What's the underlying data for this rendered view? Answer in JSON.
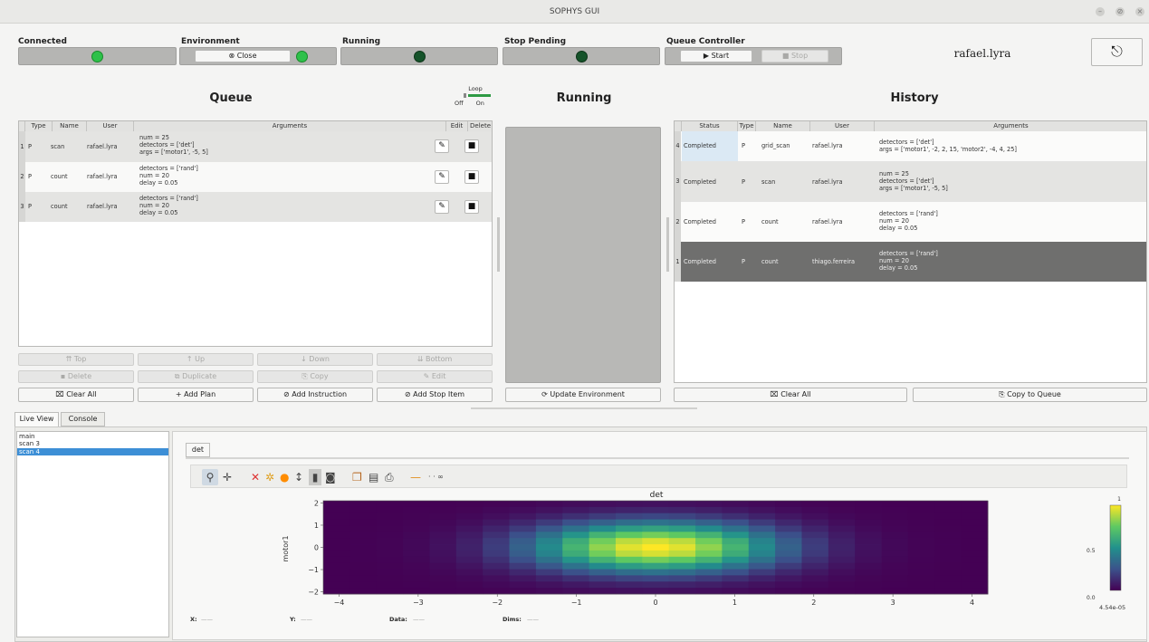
{
  "window": {
    "title": "SOPHYS GUI",
    "controls": [
      "–",
      "⊘",
      "×"
    ]
  },
  "status": {
    "connected": "Connected",
    "environment": "Environment",
    "close_label": "Close",
    "running": "Running",
    "stop_pending": "Stop Pending",
    "queue_controller": "Queue Controller",
    "start_label": "Start",
    "stop_label": "Stop",
    "user": "rafael.lyra"
  },
  "queue": {
    "title": "Queue",
    "loop_label": "Loop",
    "loop_off": "Off",
    "loop_on": "On",
    "columns": [
      "Type",
      "Name",
      "User",
      "Arguments",
      "Edit",
      "Delete"
    ],
    "rows": [
      {
        "num": "1",
        "type": "P",
        "name": "scan",
        "user": "rafael.lyra",
        "args": [
          "num = 25",
          "detectors = ['det']",
          "args = ['motor1', -5, 5]"
        ]
      },
      {
        "num": "2",
        "type": "P",
        "name": "count",
        "user": "rafael.lyra",
        "args": [
          "detectors = ['rand']",
          "num = 20",
          "delay = 0.05"
        ]
      },
      {
        "num": "3",
        "type": "P",
        "name": "count",
        "user": "rafael.lyra",
        "args": [
          "detectors = ['rand']",
          "num = 20",
          "delay = 0.05"
        ]
      }
    ],
    "buttons": {
      "top": "Top",
      "up": "Up",
      "down": "Down",
      "bottom": "Bottom",
      "delete": "Delete",
      "duplicate": "Duplicate",
      "copy": "Copy",
      "edit": "Edit",
      "clear_all": "Clear All",
      "add_plan": "Add Plan",
      "add_instruction": "Add Instruction",
      "add_stop_item": "Add Stop Item"
    }
  },
  "running": {
    "title": "Running",
    "update_env": "Update Environment"
  },
  "history": {
    "title": "History",
    "columns": [
      "Status",
      "Type",
      "Name",
      "User",
      "Arguments"
    ],
    "rows": [
      {
        "num": "4",
        "status": "Completed",
        "type": "P",
        "name": "grid_scan",
        "user": "rafael.lyra",
        "args": [
          "detectors = ['det']",
          "args = ['motor1', -2, 2, 15, 'motor2', -4, 4, 25]"
        ]
      },
      {
        "num": "3",
        "status": "Completed",
        "type": "P",
        "name": "scan",
        "user": "rafael.lyra",
        "args": [
          "num = 25",
          "detectors = ['det']",
          "args = ['motor1', -5, 5]"
        ]
      },
      {
        "num": "2",
        "status": "Completed",
        "type": "P",
        "name": "count",
        "user": "rafael.lyra",
        "args": [
          "detectors = ['rand']",
          "num = 20",
          "delay = 0.05"
        ]
      },
      {
        "num": "1",
        "status": "Completed",
        "type": "P",
        "name": "count",
        "user": "thiago.ferreira",
        "args": [
          "detectors = ['rand']",
          "num = 20",
          "delay = 0.05"
        ]
      }
    ],
    "buttons": {
      "clear_all": "Clear All",
      "copy_to_queue": "Copy to Queue"
    }
  },
  "bottom": {
    "tabs": [
      "Live View",
      "Console"
    ],
    "runs": [
      "main",
      "scan 3",
      "scan 4"
    ],
    "selected_run": "scan 4",
    "plot_tab": "det",
    "readouts": {
      "x": "X:",
      "y": "Y:",
      "data": "Data:",
      "dims": "Dims:",
      "x_val": "——",
      "y_val": "——",
      "data_val": "——",
      "dims_val": "——"
    }
  },
  "chart_data": {
    "type": "heatmap",
    "title": "det",
    "xlabel": "",
    "ylabel": "motor1",
    "x_ticks": [
      "−4",
      "−3",
      "−2",
      "−1",
      "0",
      "1",
      "2",
      "3",
      "4"
    ],
    "y_ticks": [
      "2",
      "1",
      "0",
      "−1",
      "−2"
    ],
    "xlim": [
      -4.2,
      4.2
    ],
    "ylim": [
      -2.1,
      2.1
    ],
    "grid_cols": 25,
    "grid_rows": 15,
    "peak": [
      0,
      0
    ],
    "colormap": "viridis",
    "colorbar_ticks": [
      "1",
      "0.5",
      "0.0",
      "4.54e-05"
    ]
  }
}
